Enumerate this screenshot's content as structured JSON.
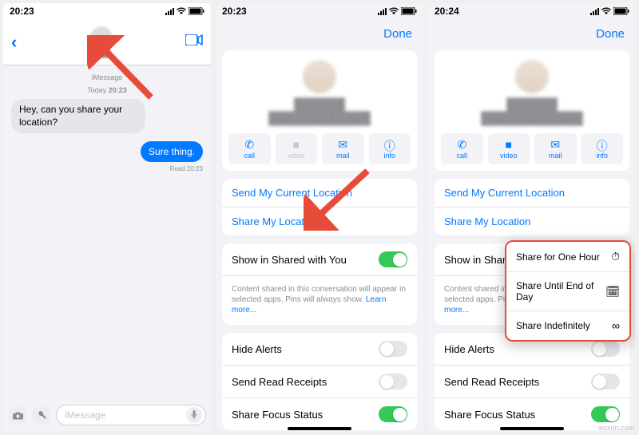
{
  "s1": {
    "time": "20:23",
    "imsg_label": "iMessage",
    "stamp_prefix": "Today",
    "stamp_time": "20:23",
    "msg_in": "Hey, can you share your location?",
    "msg_out": "Sure thing.",
    "read_label": "Read 20:23",
    "input_placeholder": "iMessage"
  },
  "s2": {
    "time": "20:23",
    "done": "Done",
    "actions": {
      "call": "call",
      "video": "video",
      "mail": "mail",
      "info": "info"
    },
    "links": {
      "send_current": "Send My Current Location",
      "share": "Share My Location"
    },
    "shared": {
      "label": "Show in Shared with You",
      "desc_a": "Content shared in this conversation will appear in selected apps. Pins will always show. ",
      "learn": "Learn more..."
    },
    "rows": {
      "hide_alerts": "Hide Alerts",
      "send_receipts": "Send Read Receipts",
      "focus": "Share Focus Status"
    }
  },
  "s3": {
    "time": "20:24",
    "done": "Done",
    "popup": {
      "hour": "Share for One Hour",
      "eod": "Share Until End of Day",
      "indef": "Share Indefinitely"
    }
  },
  "watermark": "wsxdn.com"
}
